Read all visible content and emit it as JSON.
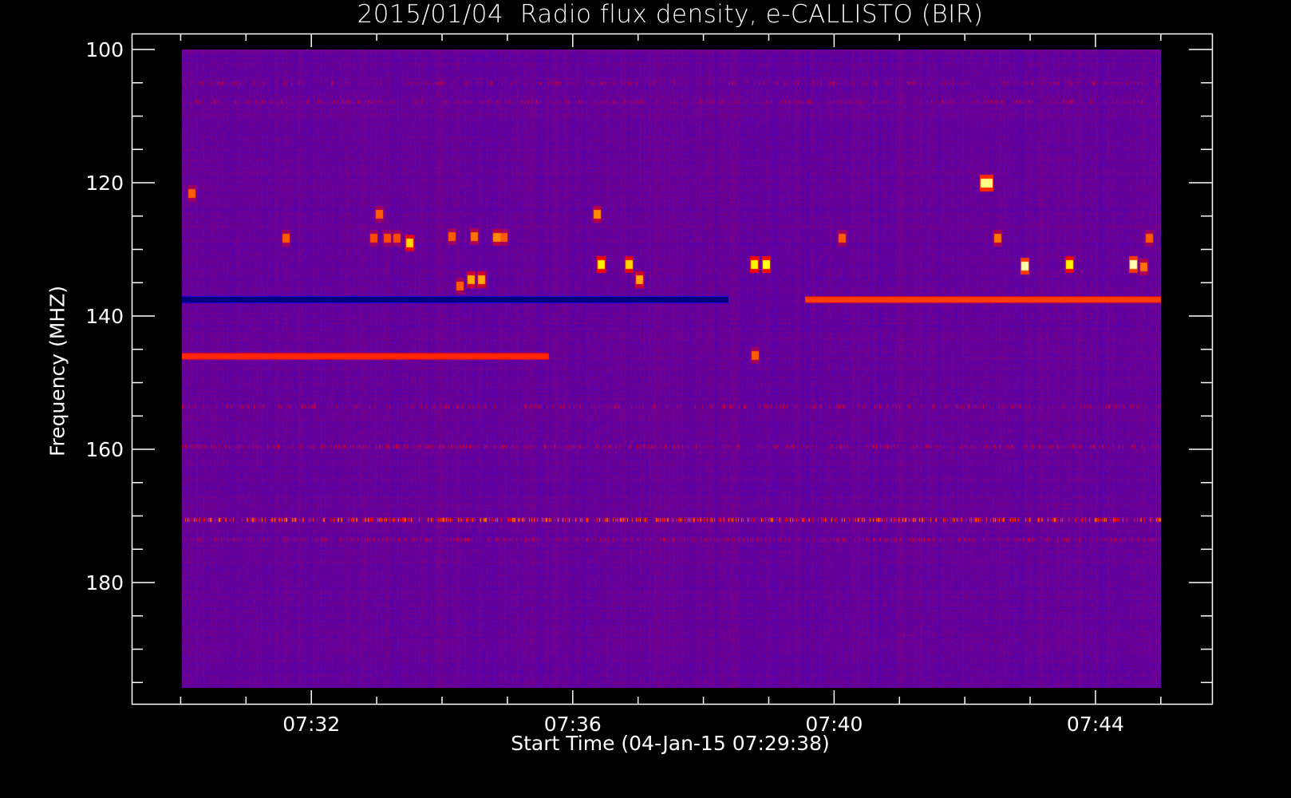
{
  "chart_data": {
    "type": "heatmap",
    "title": "2015/01/04  Radio flux density, e-CALLISTO (BIR)",
    "xlabel": "Start Time (04-Jan-15 07:29:38)",
    "ylabel": "Frequency (MHZ)",
    "x_range": [
      "07:29:38",
      "07:45:00"
    ],
    "x_axis_range": [
      "07:29:15",
      "07:45:47"
    ],
    "y_range": [
      100,
      196
    ],
    "y_axis_range": [
      100,
      198.2
    ],
    "y_inverted": true,
    "x_ticks": [
      "07:32",
      "07:36",
      "07:40",
      "07:44"
    ],
    "x_minor_tick_step_minutes": 1,
    "y_ticks": [
      100,
      120,
      140,
      160,
      180
    ],
    "y_minor_tick_step_mhz": 5,
    "colormap": [
      "#000000",
      "#0000ff",
      "#800080",
      "#ff0000",
      "#ff8000",
      "#ffff00",
      "#ffffff"
    ],
    "background_level": 0.3,
    "bands": [
      {
        "freq_mhz": 146,
        "start": "07:29:38",
        "end": "07:35:15",
        "level": 0.55
      },
      {
        "freq_mhz": 137.5,
        "start": "07:29:38",
        "end": "07:38:00",
        "level": 0.08
      },
      {
        "freq_mhz": 137.5,
        "start": "07:39:10",
        "end": "07:45:00",
        "level": 0.58
      },
      {
        "freq_mhz": 170.5,
        "start": "07:29:38",
        "end": "07:45:00",
        "level": 0.62,
        "pulsed": true
      },
      {
        "freq_mhz": 153.5,
        "start": "07:29:38",
        "end": "07:45:00",
        "level": 0.4,
        "pulsed": true
      },
      {
        "freq_mhz": 159.5,
        "start": "07:29:38",
        "end": "07:45:00",
        "level": 0.42,
        "pulsed": true
      },
      {
        "freq_mhz": 173.5,
        "start": "07:29:38",
        "end": "07:45:00",
        "level": 0.4,
        "pulsed": true
      },
      {
        "freq_mhz": 105,
        "start": "07:29:38",
        "end": "07:45:00",
        "level": 0.38,
        "pulsed": true
      },
      {
        "freq_mhz": 107.8,
        "start": "07:29:38",
        "end": "07:45:00",
        "level": 0.38,
        "pulsed": true
      }
    ],
    "bursts": [
      {
        "time": "07:29:47",
        "freq_mhz": 121.5,
        "level": 0.62
      },
      {
        "time": "07:31:13",
        "freq_mhz": 128.3,
        "level": 0.62
      },
      {
        "time": "07:32:34",
        "freq_mhz": 128.3,
        "level": 0.6
      },
      {
        "time": "07:32:39",
        "freq_mhz": 124.7,
        "level": 0.62
      },
      {
        "time": "07:32:46",
        "freq_mhz": 128.3,
        "level": 0.6
      },
      {
        "time": "07:32:55",
        "freq_mhz": 128.3,
        "level": 0.6
      },
      {
        "time": "07:33:07",
        "freq_mhz": 129.0,
        "level": 0.78
      },
      {
        "time": "07:33:46",
        "freq_mhz": 128.0,
        "level": 0.62
      },
      {
        "time": "07:33:53",
        "freq_mhz": 135.5,
        "level": 0.62
      },
      {
        "time": "07:34:03",
        "freq_mhz": 134.5,
        "level": 0.72
      },
      {
        "time": "07:34:06",
        "freq_mhz": 128.0,
        "level": 0.65
      },
      {
        "time": "07:34:13",
        "freq_mhz": 134.5,
        "level": 0.72
      },
      {
        "time": "07:34:27",
        "freq_mhz": 128.2,
        "level": 0.68
      },
      {
        "time": "07:34:33",
        "freq_mhz": 128.2,
        "level": 0.62
      },
      {
        "time": "07:35:59",
        "freq_mhz": 124.7,
        "level": 0.68
      },
      {
        "time": "07:36:03",
        "freq_mhz": 132.2,
        "level": 0.82
      },
      {
        "time": "07:36:28",
        "freq_mhz": 132.2,
        "level": 0.78
      },
      {
        "time": "07:36:38",
        "freq_mhz": 134.5,
        "level": 0.72
      },
      {
        "time": "07:38:23",
        "freq_mhz": 132.2,
        "level": 0.82
      },
      {
        "time": "07:38:24",
        "freq_mhz": 145.9,
        "level": 0.62
      },
      {
        "time": "07:38:34",
        "freq_mhz": 132.2,
        "level": 0.85
      },
      {
        "time": "07:39:44",
        "freq_mhz": 128.3,
        "level": 0.62
      },
      {
        "time": "07:41:54",
        "freq_mhz": 120.0,
        "level": 0.92
      },
      {
        "time": "07:41:59",
        "freq_mhz": 120.0,
        "level": 0.92
      },
      {
        "time": "07:42:07",
        "freq_mhz": 128.3,
        "level": 0.65
      },
      {
        "time": "07:42:32",
        "freq_mhz": 132.4,
        "level": 0.95
      },
      {
        "time": "07:43:13",
        "freq_mhz": 132.2,
        "level": 0.82
      },
      {
        "time": "07:44:11",
        "freq_mhz": 132.2,
        "level": 0.95
      },
      {
        "time": "07:44:21",
        "freq_mhz": 132.6,
        "level": 0.65
      },
      {
        "time": "07:44:26",
        "freq_mhz": 128.3,
        "level": 0.62
      }
    ]
  }
}
